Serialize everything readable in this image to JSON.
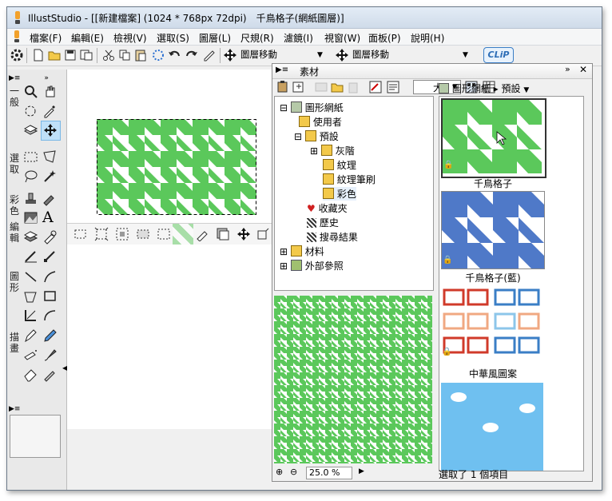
{
  "window": {
    "title": "IllustStudio - [[新建檔案] (1024 * 768px 72dpi)　千鳥格子(網紙圖層)]"
  },
  "menu": [
    "檔案(F)",
    "編輯(E)",
    "檢視(V)",
    "選取(S)",
    "圖層(L)",
    "尺規(R)",
    "濾鏡(I)",
    "視窗(W)",
    "面板(P)",
    "說明(H)"
  ],
  "toolbar": {
    "dropdown1": "圖層移動",
    "dropdown2": "圖層移動",
    "clip_logo": "CLiP"
  },
  "tool_groups": {
    "general": "一般",
    "select": "選取",
    "color": "彩色",
    "edit": "編輯",
    "shape": "圖形",
    "draw": "描畫"
  },
  "material_panel": {
    "title": "素材",
    "size_select": "大",
    "path_current": "圖形網紙",
    "path_sub": "預設",
    "tree": [
      {
        "label": "圖形網紙",
        "expanded": true
      },
      {
        "label": "使用者"
      },
      {
        "label": "預設",
        "expanded": true
      },
      {
        "label": "灰階"
      },
      {
        "label": "紋理"
      },
      {
        "label": "紋理筆刷"
      },
      {
        "label": "彩色",
        "selected": true
      },
      {
        "label": "收藏夾"
      },
      {
        "label": "歷史"
      },
      {
        "label": "搜尋結果"
      },
      {
        "label": "材料"
      },
      {
        "label": "外部參照"
      }
    ],
    "thumbnails": [
      {
        "label": "千鳥格子",
        "color": "#5bc85b",
        "selected": true
      },
      {
        "label": "千鳥格子(藍)",
        "color": "#4f79c8"
      },
      {
        "label": "中華風圖案",
        "color": "#d03a2a"
      },
      {
        "label": "",
        "color": "#6fc0f0"
      }
    ],
    "zoom": "25.0 %",
    "status": "選取了 1 個項目"
  }
}
